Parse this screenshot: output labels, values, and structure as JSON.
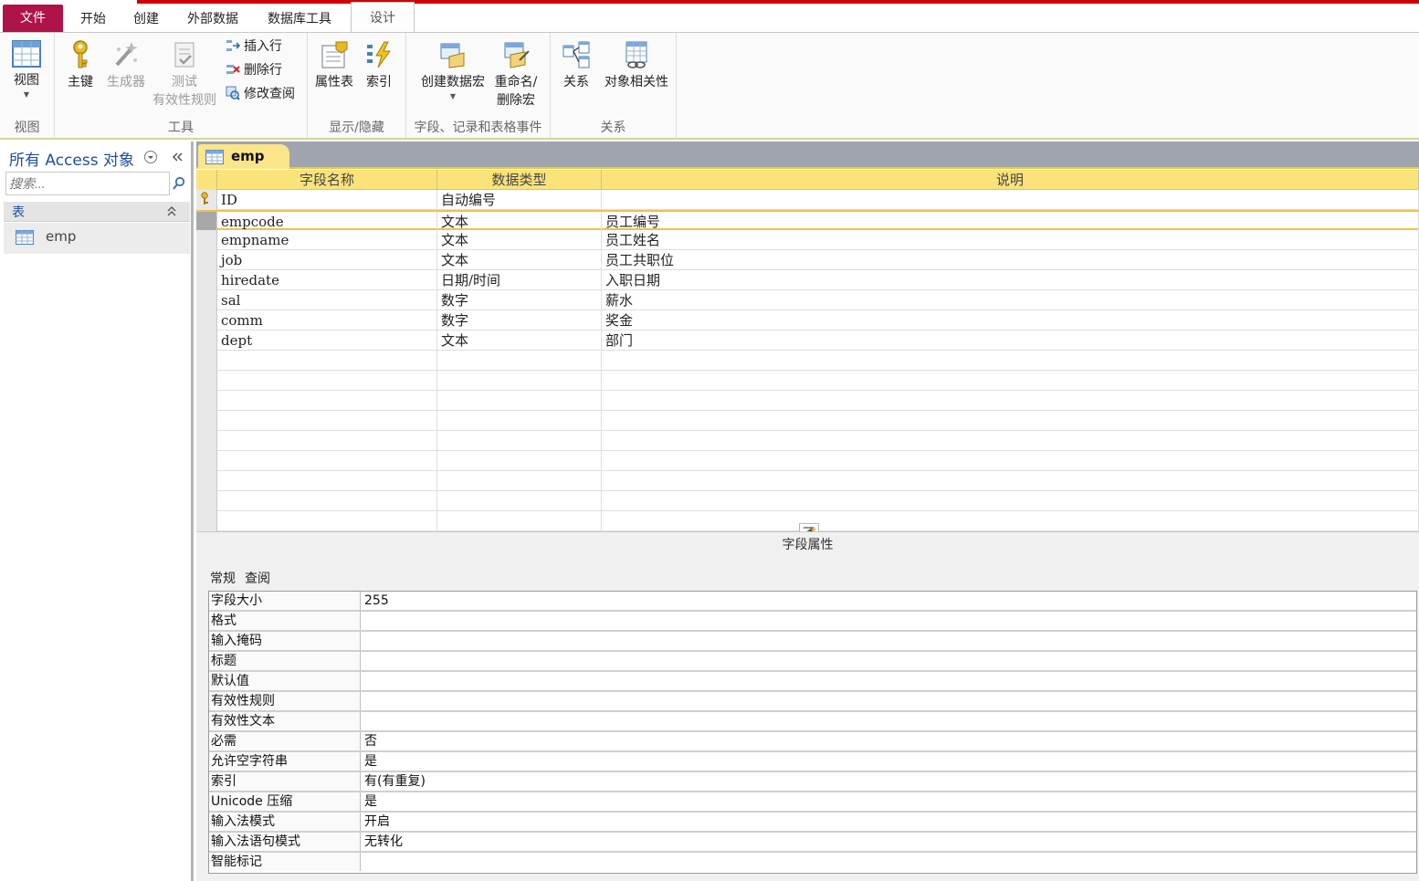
{
  "tabs": {
    "file": "文件",
    "home": "开始",
    "create": "创建",
    "external": "外部数据",
    "dbtools": "数据库工具",
    "design": "设计"
  },
  "ribbon": {
    "view_group": {
      "view": "视图",
      "label": "视图"
    },
    "tools_group": {
      "primary_key": "主键",
      "builder": "生成器",
      "test_line1": "测试",
      "test_line2": "有效性规则",
      "insert_row": "插入行",
      "delete_row": "删除行",
      "modify_lookup": "修改查阅",
      "label": "工具"
    },
    "show_group": {
      "property_sheet": "属性表",
      "indexes": "索引",
      "label": "显示/隐藏"
    },
    "events_group": {
      "create_macro": "创建数据宏",
      "rename_line1": "重命名/",
      "rename_line2": "删除宏",
      "label": "字段、记录和表格事件"
    },
    "rel_group": {
      "relationships": "关系",
      "dependencies": "对象相关性",
      "label": "关系"
    }
  },
  "nav": {
    "title": "所有 Access 对象",
    "search_placeholder": "搜索...",
    "section": "表",
    "items": [
      {
        "label": "emp"
      }
    ]
  },
  "document": {
    "tab": "emp"
  },
  "grid": {
    "headers": [
      "字段名称",
      "数据类型",
      "说明"
    ],
    "rows": [
      {
        "name": "ID",
        "type": "自动编号",
        "desc": ""
      },
      {
        "name": "empcode",
        "type": "文本",
        "desc": "员工编号"
      },
      {
        "name": "empname",
        "type": "文本",
        "desc": "员工姓名"
      },
      {
        "name": "job",
        "type": "文本",
        "desc": "员工共职位"
      },
      {
        "name": "hiredate",
        "type": "日期/时间",
        "desc": "入职日期"
      },
      {
        "name": "sal",
        "type": "数字",
        "desc": "薪水"
      },
      {
        "name": "comm",
        "type": "数字",
        "desc": "奖金"
      },
      {
        "name": "dept",
        "type": "文本",
        "desc": "部门"
      }
    ]
  },
  "properties": {
    "title": "字段属性",
    "tab_general": "常规",
    "tab_lookup": "查阅",
    "rows": [
      {
        "name": "字段大小",
        "value": "255"
      },
      {
        "name": "格式",
        "value": ""
      },
      {
        "name": "输入掩码",
        "value": ""
      },
      {
        "name": "标题",
        "value": ""
      },
      {
        "name": "默认值",
        "value": ""
      },
      {
        "name": "有效性规则",
        "value": ""
      },
      {
        "name": "有效性文本",
        "value": ""
      },
      {
        "name": "必需",
        "value": "否"
      },
      {
        "name": "允许空字符串",
        "value": "是"
      },
      {
        "name": "索引",
        "value": "有(有重复)"
      },
      {
        "name": "Unicode 压缩",
        "value": "是"
      },
      {
        "name": "输入法模式",
        "value": "开启"
      },
      {
        "name": "输入法语句模式",
        "value": "无转化"
      },
      {
        "name": "智能标记",
        "value": ""
      }
    ]
  },
  "colors": {
    "accent_file": "#b0124a",
    "header_yellow": "#fbe37c",
    "nav_blue": "#1f4e9a"
  }
}
